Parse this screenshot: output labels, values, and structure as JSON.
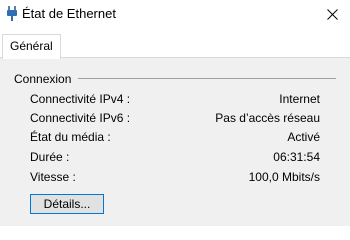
{
  "window": {
    "title": "État de Ethernet",
    "icon": "ethernet-plug-icon"
  },
  "tabs": [
    {
      "label": "Général",
      "selected": true
    }
  ],
  "connection": {
    "group_label": "Connexion",
    "rows": [
      {
        "label": "Connectivité IPv4 :",
        "value": "Internet"
      },
      {
        "label": "Connectivité IPv6 :",
        "value": "Pas d’accès réseau"
      },
      {
        "label": "État du média :",
        "value": "Activé"
      },
      {
        "label": "Durée :",
        "value": "06:31:54"
      },
      {
        "label": "Vitesse :",
        "value": "100,0 Mbits/s"
      }
    ]
  },
  "buttons": {
    "details_label": "Détails..."
  },
  "colors": {
    "panel_bg": "#f0f0f0",
    "button_focus_border": "#0078d7"
  }
}
